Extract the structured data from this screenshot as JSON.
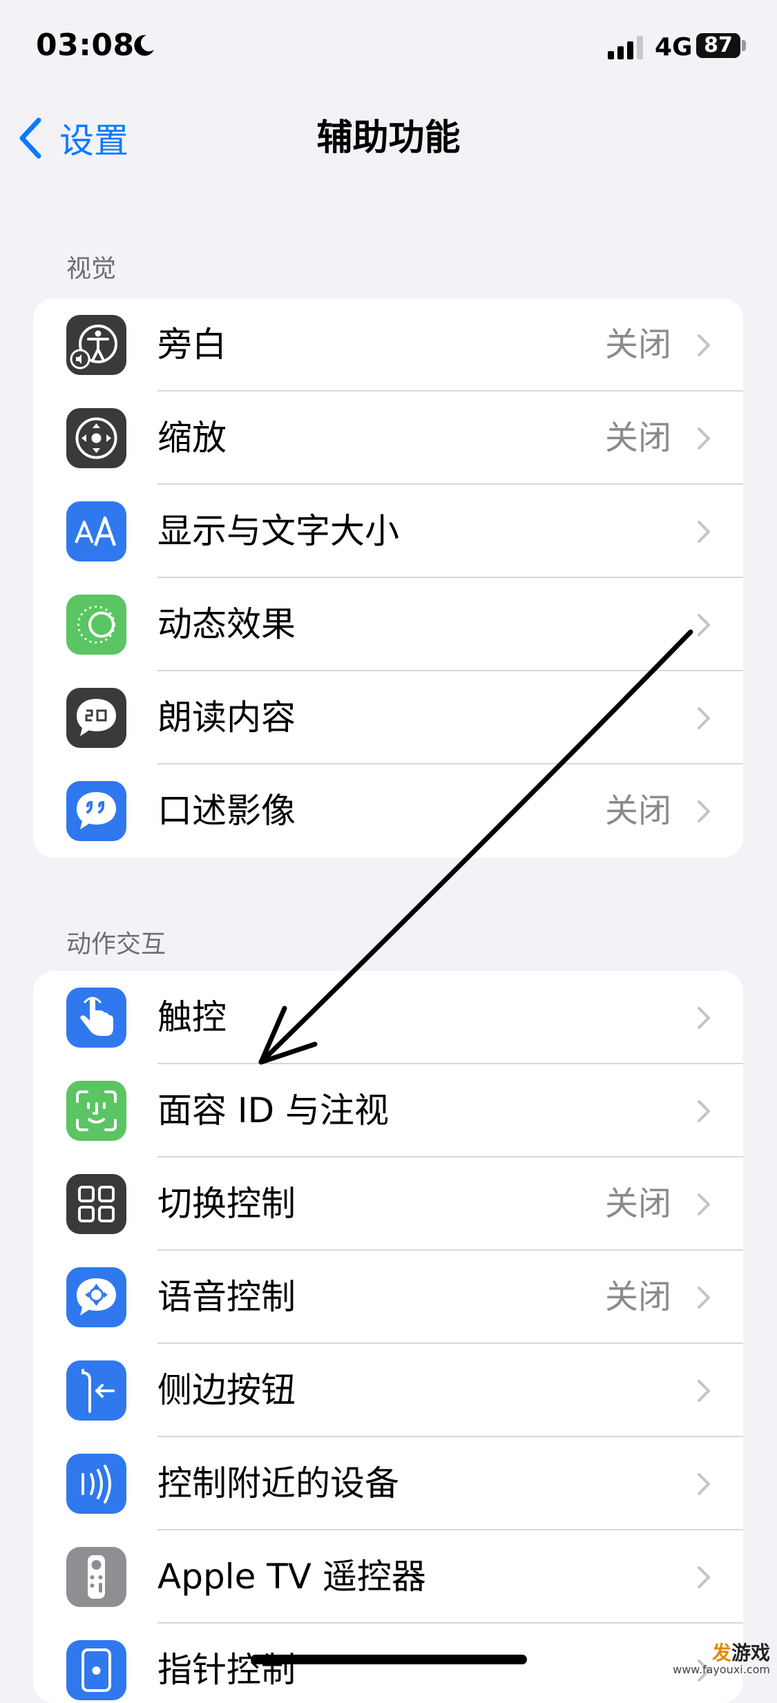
{
  "status_bar": {
    "time": "03:08",
    "network": "4G",
    "battery": "87"
  },
  "nav": {
    "back_label": "设置",
    "title": "辅助功能"
  },
  "sections": [
    {
      "header": "视觉",
      "rows": [
        {
          "label": "旁白",
          "value": "关闭",
          "icon": "voiceover-icon"
        },
        {
          "label": "缩放",
          "value": "关闭",
          "icon": "zoom-icon"
        },
        {
          "label": "显示与文字大小",
          "value": "",
          "icon": "text-size-icon"
        },
        {
          "label": "动态效果",
          "value": "",
          "icon": "motion-icon"
        },
        {
          "label": "朗读内容",
          "value": "",
          "icon": "spoken-content-icon"
        },
        {
          "label": "口述影像",
          "value": "关闭",
          "icon": "audio-description-icon"
        }
      ]
    },
    {
      "header": "动作交互",
      "rows": [
        {
          "label": "触控",
          "value": "",
          "icon": "touch-icon"
        },
        {
          "label": "面容 ID 与注视",
          "value": "",
          "icon": "face-id-icon"
        },
        {
          "label": "切换控制",
          "value": "关闭",
          "icon": "switch-control-icon"
        },
        {
          "label": "语音控制",
          "value": "关闭",
          "icon": "voice-control-icon"
        },
        {
          "label": "侧边按钮",
          "value": "",
          "icon": "side-button-icon"
        },
        {
          "label": "控制附近的设备",
          "value": "",
          "icon": "nearby-devices-icon"
        },
        {
          "label": "Apple TV 遥控器",
          "value": "",
          "icon": "apple-tv-remote-icon"
        },
        {
          "label": "指针控制",
          "value": "",
          "icon": "pointer-control-icon"
        }
      ]
    }
  ],
  "watermark": {
    "main_accent": "发",
    "main": "游戏",
    "sub": "www.fayouxi.com"
  },
  "colors": {
    "accent": "#0a7aff",
    "background": "#f2f2f7",
    "icon_dark": "#3a3a3c",
    "icon_blue": "#2f78ee",
    "icon_green": "#5ac562",
    "icon_gray": "#8e8e93",
    "secondary_text": "#8a8a8e"
  }
}
